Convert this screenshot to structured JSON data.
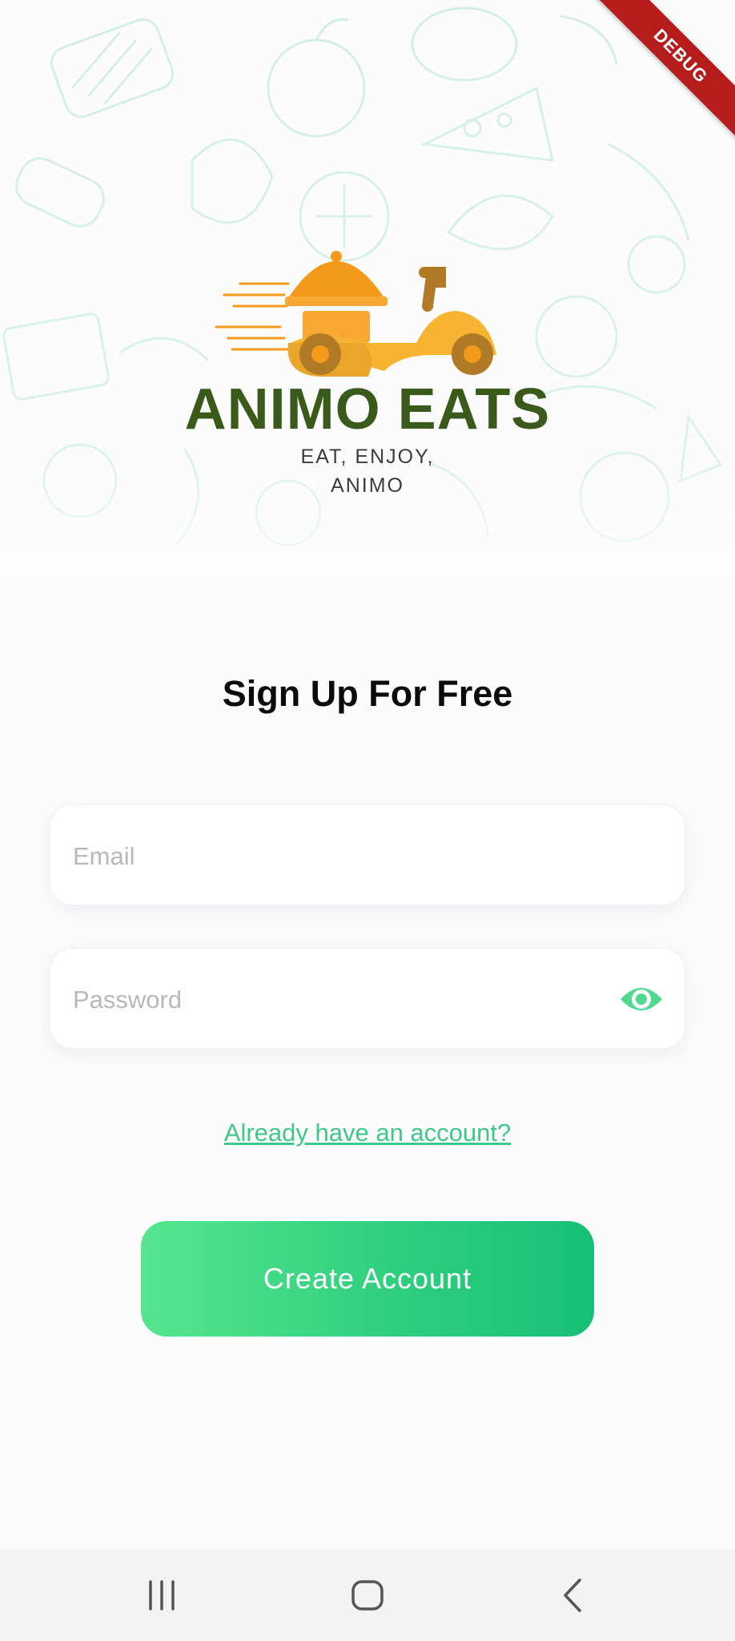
{
  "app": {
    "brand_name": "ANIMO EATS",
    "tagline_line1": "EAT, ENJOY,",
    "tagline_line2": "ANIMO",
    "debug_banner": "DEBUG"
  },
  "form": {
    "heading": "Sign Up For Free",
    "email": {
      "value": "",
      "placeholder": "Email"
    },
    "password": {
      "value": "",
      "placeholder": "Password",
      "toggle_icon": "eye-icon"
    },
    "login_link": "Already have an account?",
    "submit_label": "Create Account"
  },
  "navbar": {
    "icons": [
      "recent-apps-icon",
      "home-icon",
      "back-icon"
    ]
  },
  "colors": {
    "brand_green": "#3a5a1c",
    "accent_green": "#3ec98a",
    "logo_orange": "#f39a1d",
    "logo_brown": "#b07a26",
    "debug_red": "#b71c1c"
  }
}
